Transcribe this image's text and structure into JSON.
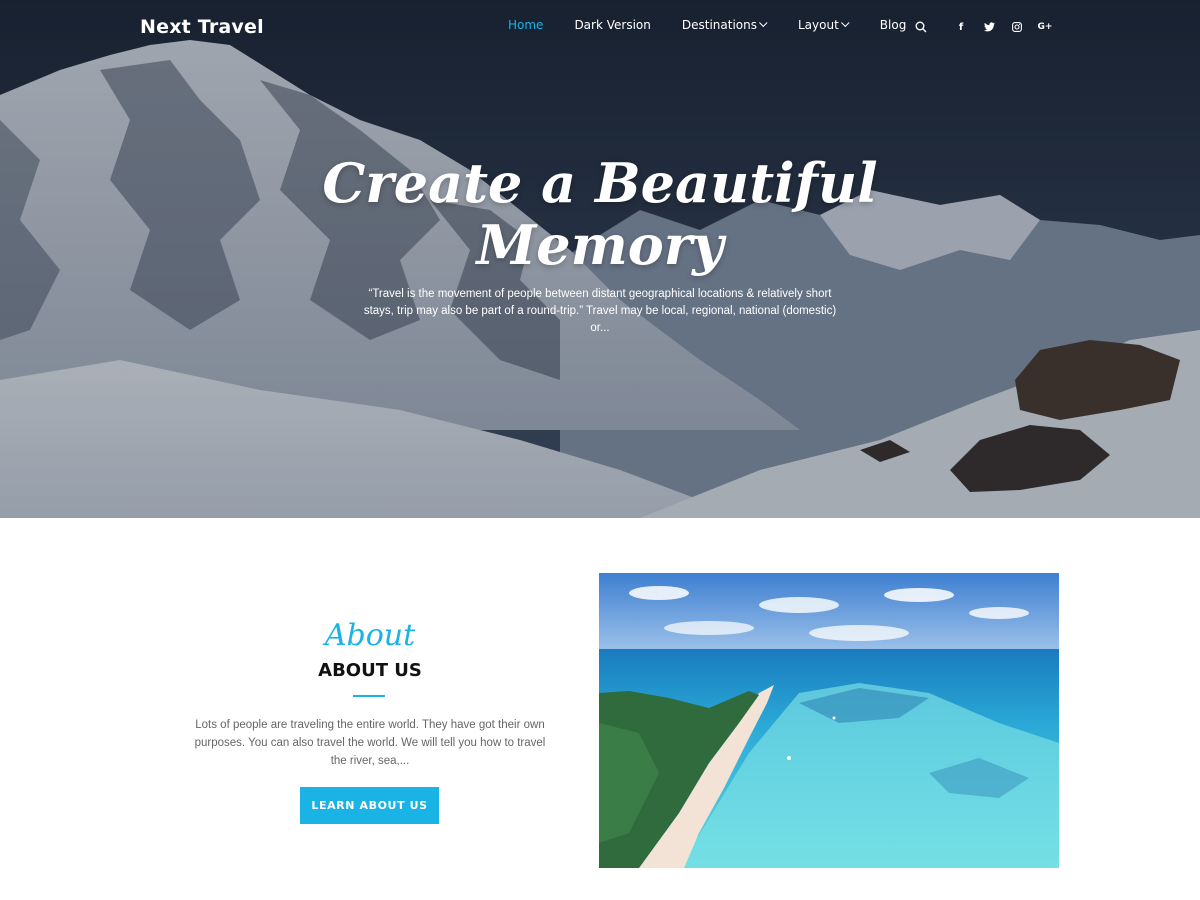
{
  "header": {
    "brand": "Next Travel",
    "nav": [
      {
        "label": "Home",
        "active": true,
        "dropdown": false
      },
      {
        "label": "Dark Version",
        "active": false,
        "dropdown": false
      },
      {
        "label": "Destinations",
        "active": false,
        "dropdown": true
      },
      {
        "label": "Layout",
        "active": false,
        "dropdown": true
      },
      {
        "label": "Blog",
        "active": false,
        "dropdown": false
      }
    ],
    "search_icon": "search-icon",
    "socials": [
      {
        "name": "facebook-icon",
        "glyph": "f"
      },
      {
        "name": "twitter-icon",
        "glyph": "t"
      },
      {
        "name": "instagram-icon",
        "glyph": "◎"
      },
      {
        "name": "google-plus-icon",
        "glyph": "G+"
      }
    ]
  },
  "hero": {
    "title_line1": "Create a Beautiful",
    "title_line2": "Memory",
    "description": "“Travel is the movement of people between distant geographical locations & relatively short stays, trip may also be part of a round-trip.” Travel may be local, regional, national (domestic) or..."
  },
  "about": {
    "script": "About",
    "title": "ABOUT US",
    "text": "Lots of people are traveling the entire world. They have got their own purposes. You can also travel the world. We will tell you how to travel the river, sea,...",
    "button": "LEARN ABOUT US"
  },
  "colors": {
    "accent": "#19b3e6",
    "nav_text": "#ffffff",
    "heading": "#111111"
  }
}
